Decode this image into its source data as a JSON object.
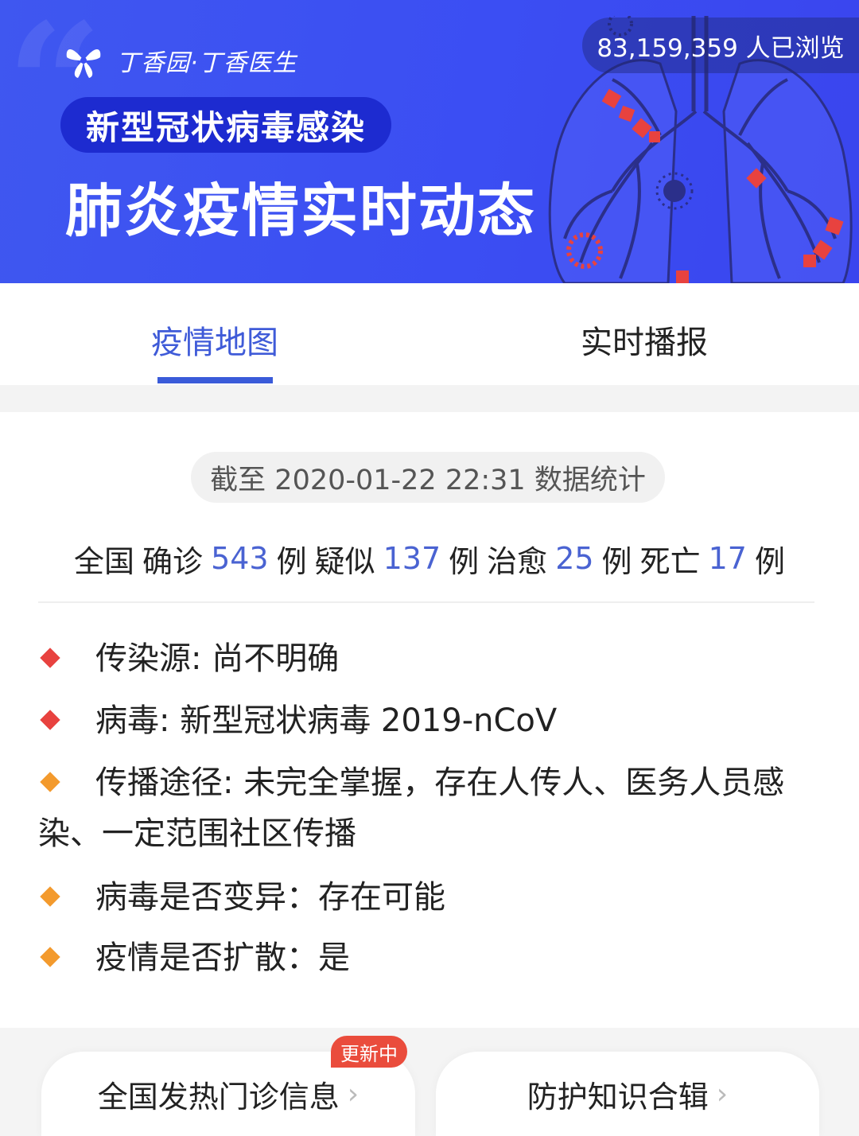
{
  "header": {
    "brand": "丁香园·丁香医生",
    "subtitle_pill": "新型冠状病毒感染",
    "title": "肺炎疫情实时动态",
    "views": "83,159,359 人已浏览",
    "colors": {
      "banner": "#3b4ef3",
      "pill": "#1d2bd0",
      "lung": "#2b2f8a",
      "virus": "#e8423f"
    }
  },
  "tabs": [
    {
      "label": "疫情地图",
      "active": true
    },
    {
      "label": "实时播报",
      "active": false
    }
  ],
  "stats": {
    "timestamp": "截至 2020-01-22 22:31 数据统计",
    "prefix": "全国",
    "confirmed_label": "确诊",
    "confirmed": "543",
    "unit1": "例",
    "suspected_label": "疑似",
    "suspected": "137",
    "unit2": "例",
    "cured_label": "治愈",
    "cured": "25",
    "unit3": "例",
    "dead_label": "死亡",
    "dead": "17",
    "unit4": "例",
    "number_color": "#4a63d2"
  },
  "info_items": [
    {
      "text": "传染源: 尚不明确",
      "bullet": "red"
    },
    {
      "text": "病毒: 新型冠状病毒 2019-nCoV",
      "bullet": "red"
    },
    {
      "text": "传播途径: 未完全掌握，存在人传人、医务人员感染、一定范围社区传播",
      "bullet": "orange"
    },
    {
      "text": "病毒是否变异：存在可能",
      "bullet": "orange"
    },
    {
      "text": "疫情是否扩散：是",
      "bullet": "orange"
    }
  ],
  "bottom": {
    "left_label": "全国发热门诊信息",
    "right_label": "防护知识合辑",
    "badge": "更新中",
    "chevron": "›"
  }
}
